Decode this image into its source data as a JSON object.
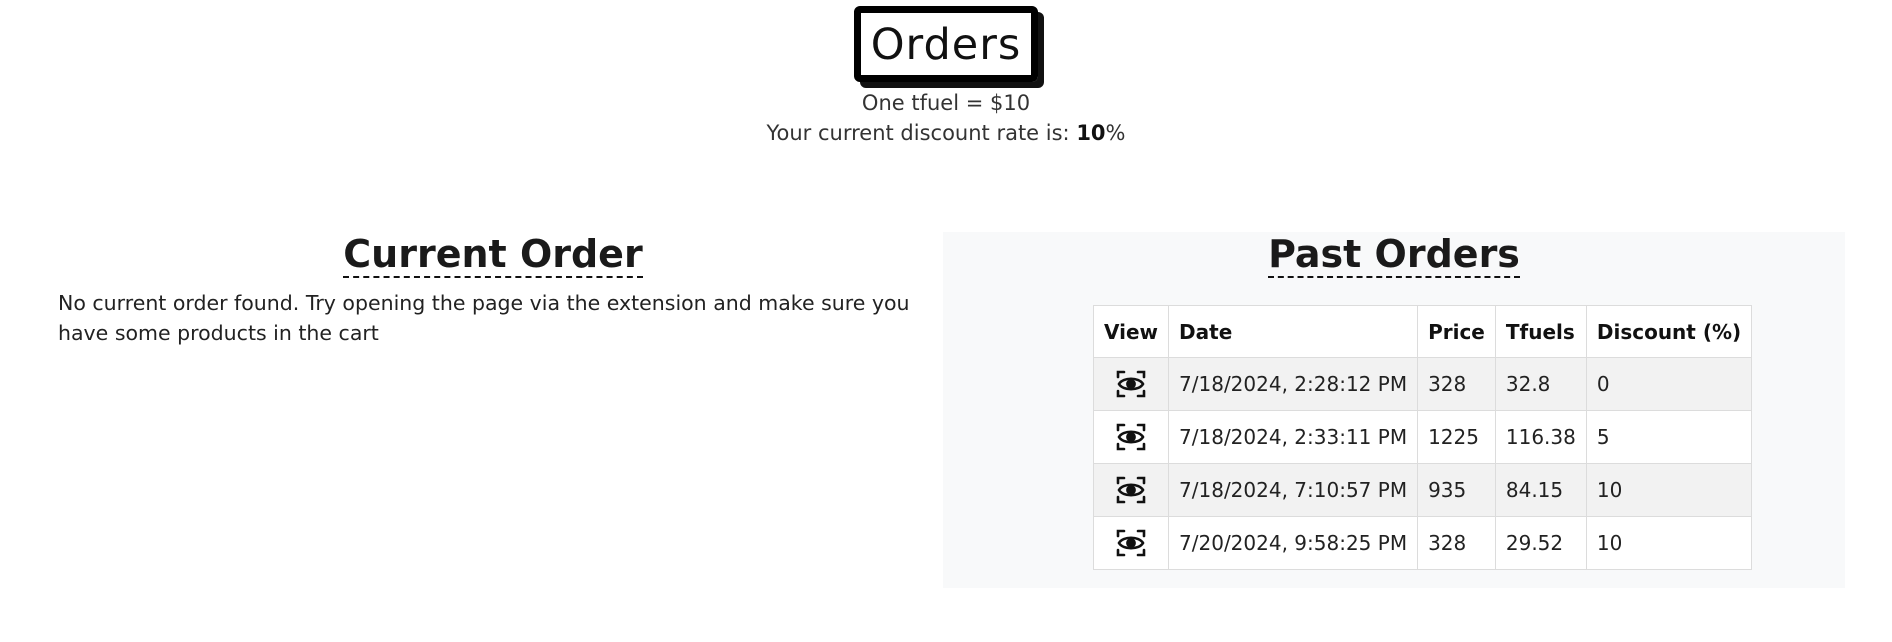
{
  "header": {
    "title": "Orders",
    "rate_text": "One tfuel = $10",
    "discount_prefix": "Your current discount rate is: ",
    "discount_value": "10",
    "discount_suffix": "%"
  },
  "current_order": {
    "heading": "Current Order",
    "message": "No current order found. Try opening the page via the extension and make sure you have some products in the cart"
  },
  "past_orders": {
    "heading": "Past Orders",
    "columns": {
      "view": "View",
      "date": "Date",
      "price": "Price",
      "tfuels": "Tfuels",
      "discount": "Discount (%)"
    },
    "view_icon": "eye-icon",
    "rows": [
      {
        "date": "7/18/2024, 2:28:12 PM",
        "price": "328",
        "tfuels": "32.8",
        "discount": "0"
      },
      {
        "date": "7/18/2024, 2:33:11 PM",
        "price": "1225",
        "tfuels": "116.38",
        "discount": "5"
      },
      {
        "date": "7/18/2024, 7:10:57 PM",
        "price": "935",
        "tfuels": "84.15",
        "discount": "10"
      },
      {
        "date": "7/20/2024, 9:58:25 PM",
        "price": "328",
        "tfuels": "29.52",
        "discount": "10"
      }
    ]
  },
  "colors": {
    "panel_background": "#f8f9fa",
    "stripe": "#f2f2f2",
    "title_border": "#000000"
  }
}
